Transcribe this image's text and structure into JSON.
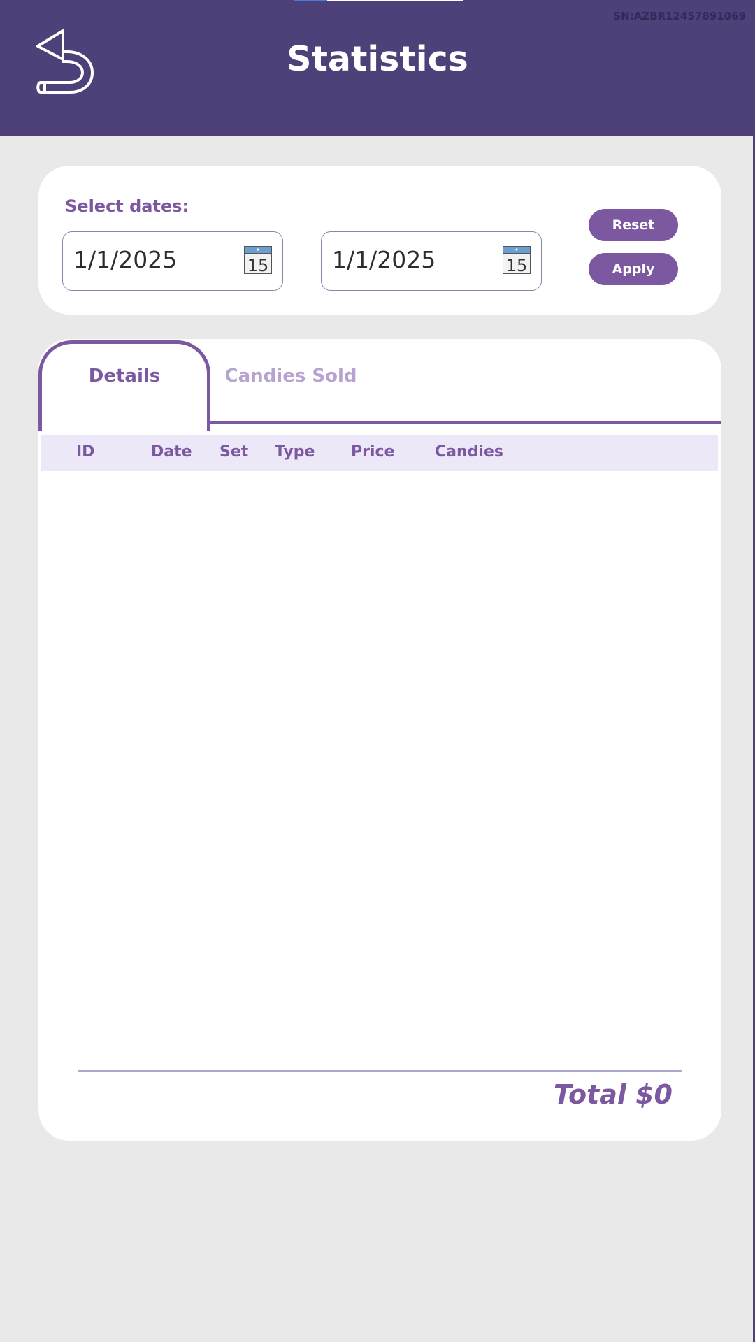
{
  "header": {
    "title": "Statistics",
    "serial": "SN:AZBR12457891069",
    "back_icon": "undo-arrow-icon"
  },
  "filters": {
    "label": "Select dates:",
    "start_date": "1/1/2025",
    "end_date": "1/1/2025",
    "calendar_icon": "calendar-icon",
    "calendar_day": "15",
    "reset_label": "Reset",
    "apply_label": "Apply"
  },
  "tabs": [
    {
      "label": "Details",
      "active": true
    },
    {
      "label": "Candies Sold",
      "active": false
    }
  ],
  "table": {
    "columns": [
      "ID",
      "Date",
      "Set",
      "Type",
      "Price",
      "Candies"
    ],
    "rows": []
  },
  "footer": {
    "total_label": "Total $0"
  },
  "colors": {
    "header_bg": "#4e4078",
    "accent": "#7c58a0",
    "inactive_tab": "#b6a3cf",
    "table_header_bg": "#ede8f8",
    "page_bg": "#e9e9e9"
  }
}
